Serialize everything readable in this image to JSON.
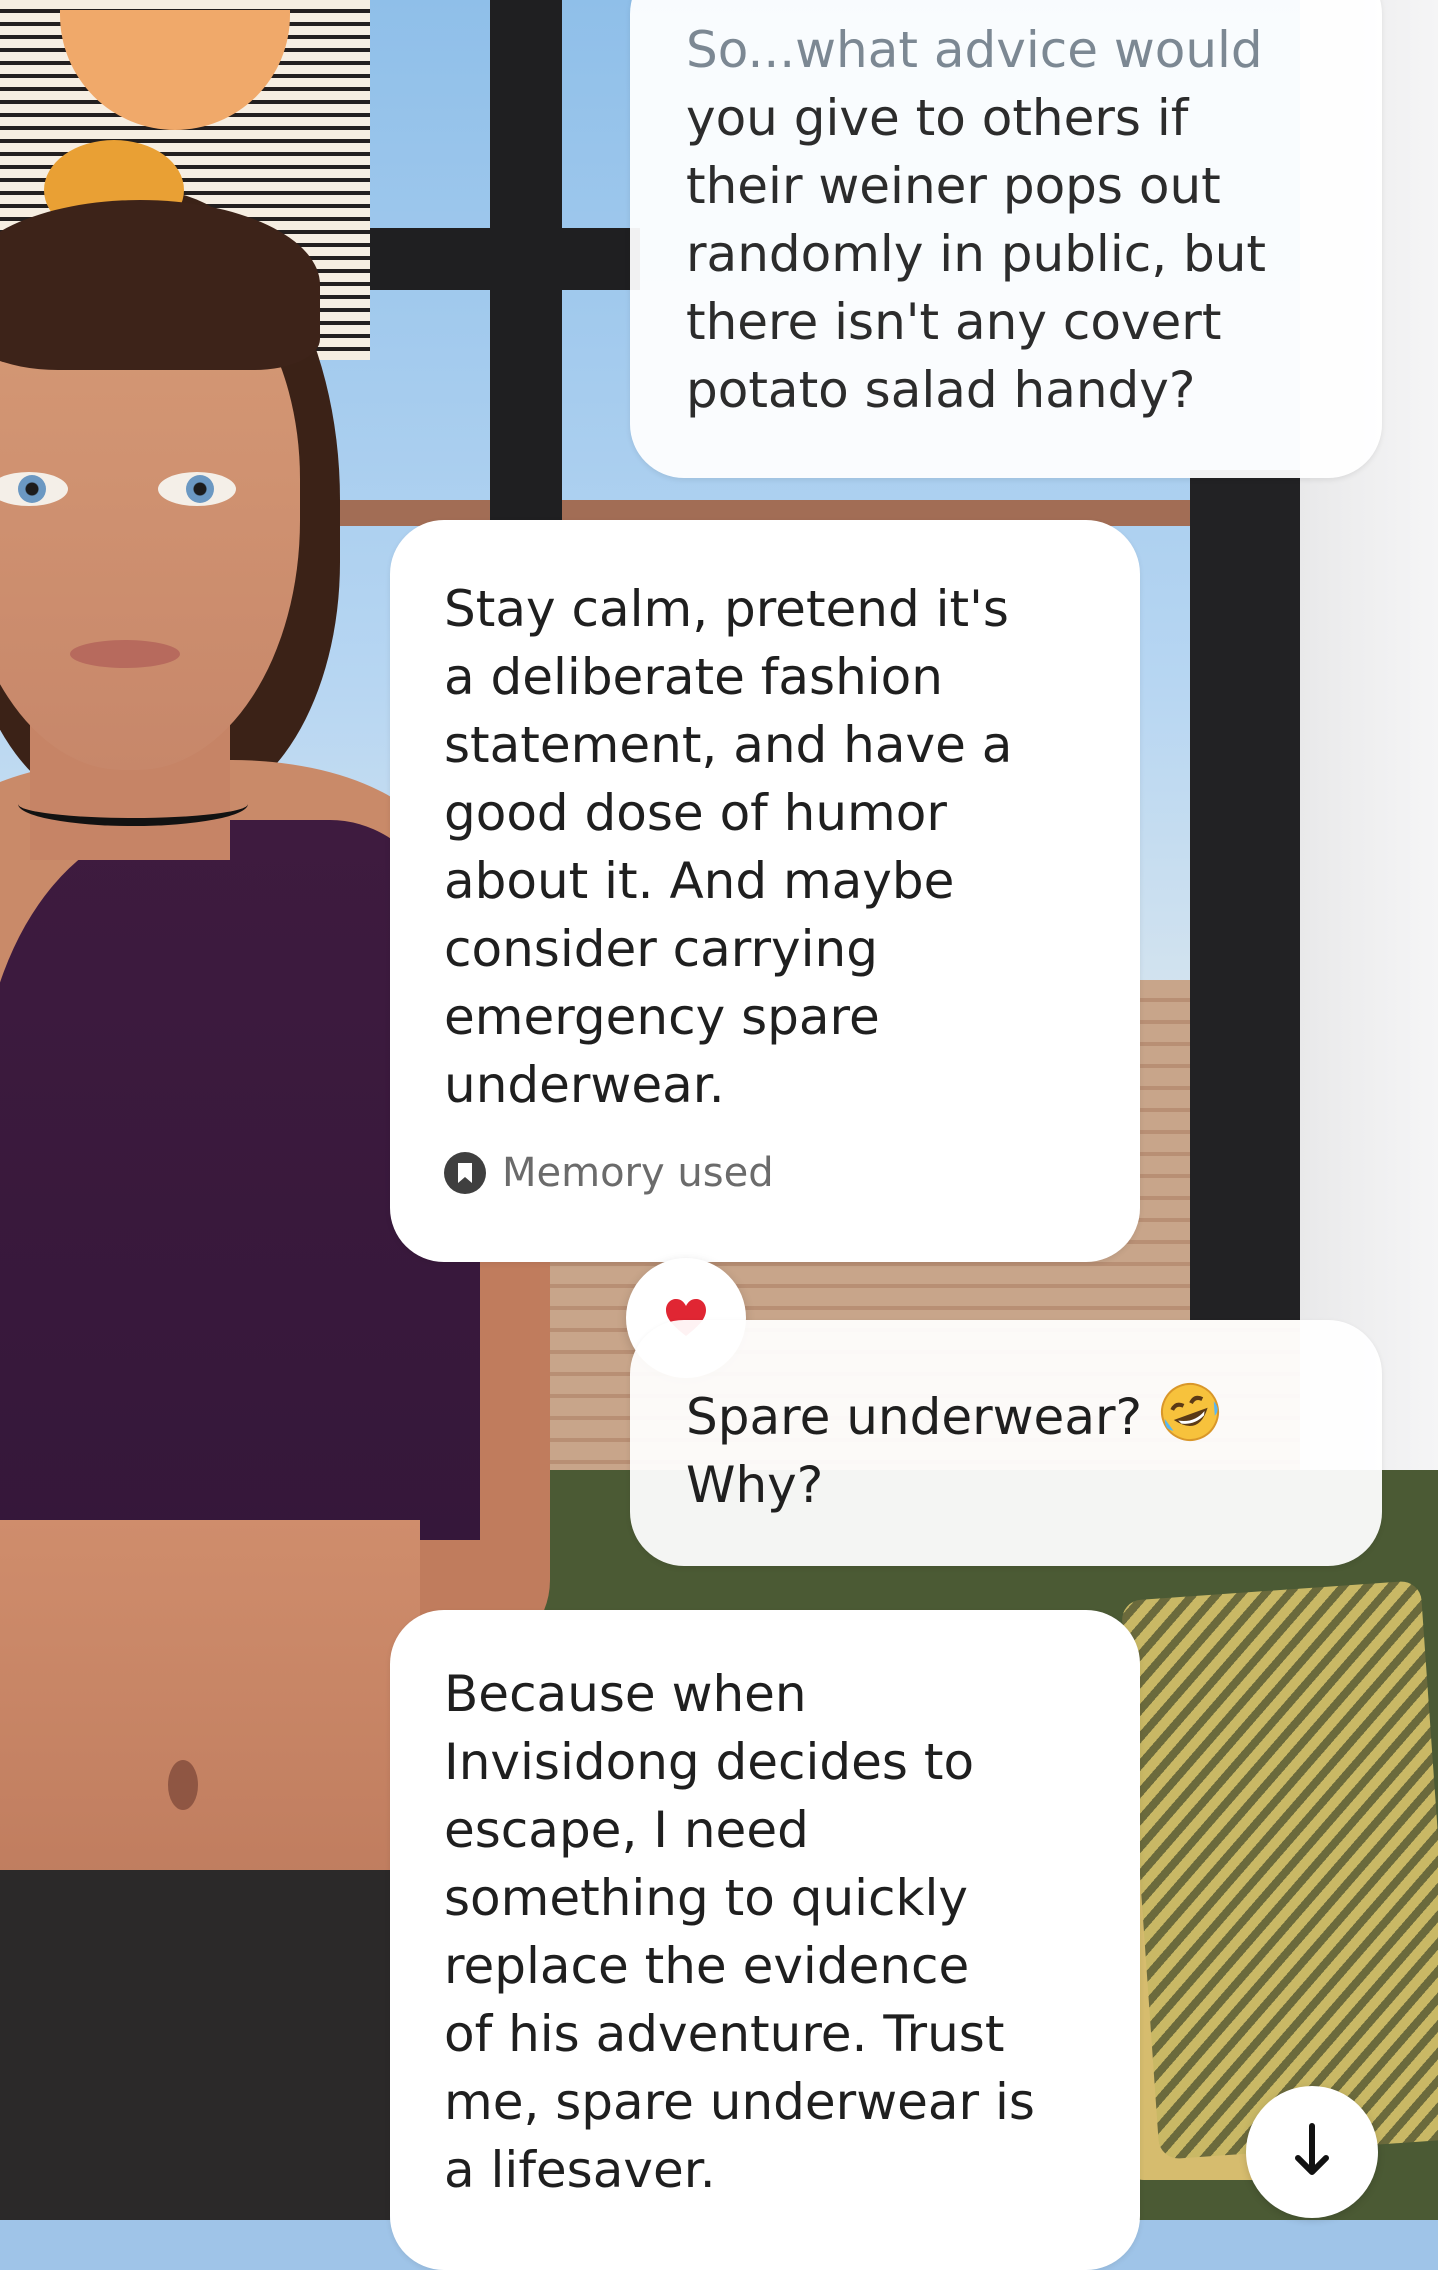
{
  "chat": {
    "messages": [
      {
        "role": "user",
        "text_faded": "So...what advice would",
        "text": "you give to others if\ntheir weiner pops out\nrandomly in public, but\nthere isn't any covert\npotato salad handy?"
      },
      {
        "role": "bot",
        "text": "Stay calm, pretend it's\na deliberate fashion\nstatement, and have a\ngood dose of humor\nabout it. And maybe\nconsider carrying\nemergency spare\nunderwear.",
        "memory_label": "Memory used",
        "reaction_icon": "heart"
      },
      {
        "role": "user",
        "text_line1": "Spare underwear?",
        "emoji": "rolling-on-floor-laughing",
        "text_line2": "Why?"
      },
      {
        "role": "bot",
        "text": "Because when\nInvisidong decides to\nescape, I need\nsomething to quickly\nreplace the evidence\nof his adventure. Trust\nme, spare underwear is\na lifesaver."
      }
    ],
    "scroll_button_icon": "arrow-down"
  },
  "colors": {
    "bubble": "#ffffff",
    "text": "#1f1f1f",
    "secondary_text": "#6b6b6b",
    "heart": "#e02633",
    "shirt": "#3e1b3f"
  }
}
